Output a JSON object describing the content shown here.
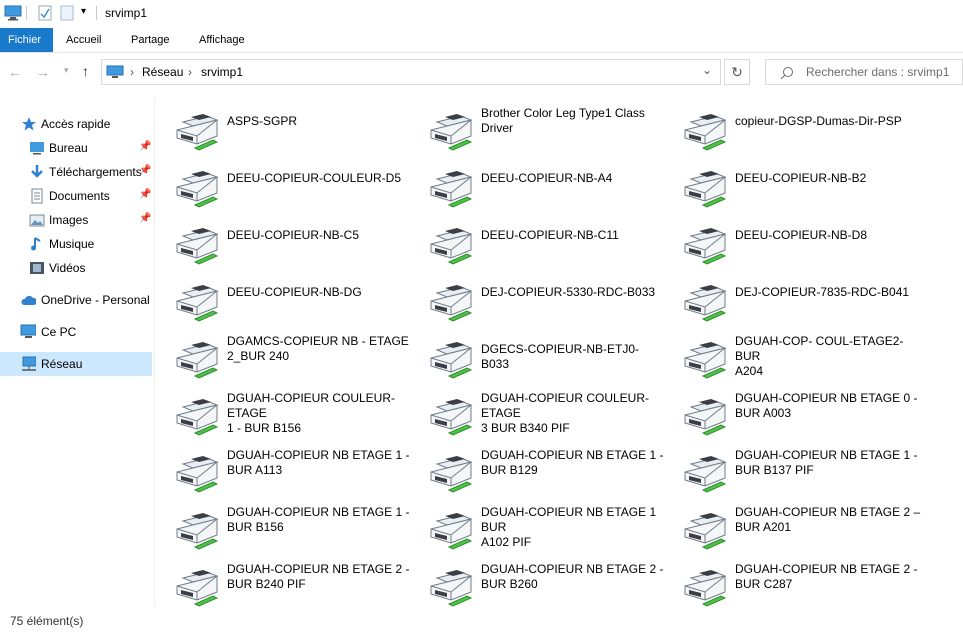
{
  "window": {
    "title": "srvimp1"
  },
  "ribbon": {
    "tabs": [
      "Fichier",
      "Accueil",
      "Partage",
      "Affichage"
    ]
  },
  "address": {
    "crumbs": [
      "Réseau",
      "srvimp1"
    ],
    "search_placeholder": "Rechercher dans : srvimp1"
  },
  "sidebar": {
    "items": [
      {
        "label": "Accès rapide",
        "icon": "star-icon"
      },
      {
        "label": "Bureau",
        "icon": "desktop-icon",
        "pinned": true
      },
      {
        "label": "Téléchargements",
        "icon": "download-icon",
        "pinned": true
      },
      {
        "label": "Documents",
        "icon": "document-icon",
        "pinned": true
      },
      {
        "label": "Images",
        "icon": "image-icon",
        "pinned": true
      },
      {
        "label": "Musique",
        "icon": "music-icon"
      },
      {
        "label": "Vidéos",
        "icon": "video-icon"
      },
      {
        "label": "OneDrive - Personal",
        "icon": "cloud-icon"
      },
      {
        "label": "Ce PC",
        "icon": "computer-icon"
      },
      {
        "label": "Réseau",
        "icon": "network-icon",
        "selected": true
      }
    ]
  },
  "items": [
    {
      "l1": "ASPS-SGPR",
      "l2": ""
    },
    {
      "l1": "Brother Color Leg Type1 Class",
      "l2": "Driver"
    },
    {
      "l1": "copieur-DGSP-Dumas-Dir-PSP",
      "l2": ""
    },
    {
      "l1": "DEEU-COPIEUR-COULEUR-D5",
      "l2": ""
    },
    {
      "l1": "DEEU-COPIEUR-NB-A4",
      "l2": ""
    },
    {
      "l1": "DEEU-COPIEUR-NB-B2",
      "l2": ""
    },
    {
      "l1": "DEEU-COPIEUR-NB-C5",
      "l2": ""
    },
    {
      "l1": "DEEU-COPIEUR-NB-C11",
      "l2": ""
    },
    {
      "l1": "DEEU-COPIEUR-NB-D8",
      "l2": ""
    },
    {
      "l1": "DEEU-COPIEUR-NB-DG",
      "l2": ""
    },
    {
      "l1": "DEJ-COPIEUR-5330-RDC-B033",
      "l2": ""
    },
    {
      "l1": "DEJ-COPIEUR-7835-RDC-B041",
      "l2": ""
    },
    {
      "l1": "DGAMCS-COPIEUR NB - ETAGE",
      "l2": "2_BUR 240"
    },
    {
      "l1": "DGECS-COPIEUR-NB-ETJ0-B033",
      "l2": ""
    },
    {
      "l1": "DGUAH-COP- COUL-ETAGE2- BUR",
      "l2": "A204"
    },
    {
      "l1": "DGUAH-COPIEUR COULEUR-ETAGE",
      "l2": "1 - BUR B156"
    },
    {
      "l1": "DGUAH-COPIEUR COULEUR-ETAGE",
      "l2": "3 BUR B340 PIF"
    },
    {
      "l1": "DGUAH-COPIEUR NB ETAGE 0 -",
      "l2": "BUR A003"
    },
    {
      "l1": "DGUAH-COPIEUR NB ETAGE 1 -",
      "l2": "BUR A113"
    },
    {
      "l1": "DGUAH-COPIEUR NB ETAGE 1 -",
      "l2": "BUR B129"
    },
    {
      "l1": "DGUAH-COPIEUR NB ETAGE 1 -",
      "l2": "BUR B137 PIF"
    },
    {
      "l1": "DGUAH-COPIEUR NB ETAGE 1 -",
      "l2": "BUR B156"
    },
    {
      "l1": "DGUAH-COPIEUR NB ETAGE 1 BUR",
      "l2": "A102 PIF"
    },
    {
      "l1": "DGUAH-COPIEUR NB ETAGE 2 –",
      "l2": "BUR A201"
    },
    {
      "l1": "DGUAH-COPIEUR NB ETAGE 2 -",
      "l2": "BUR B240 PIF"
    },
    {
      "l1": "DGUAH-COPIEUR NB ETAGE 2 -",
      "l2": "BUR B260"
    },
    {
      "l1": "DGUAH-COPIEUR NB ETAGE 2 -",
      "l2": "BUR C287"
    }
  ],
  "status": {
    "count": "75 élément(s)"
  },
  "colors": {
    "accent": "#1979ca",
    "selected": "#cce8ff",
    "printer_green": "#3fb93a"
  }
}
